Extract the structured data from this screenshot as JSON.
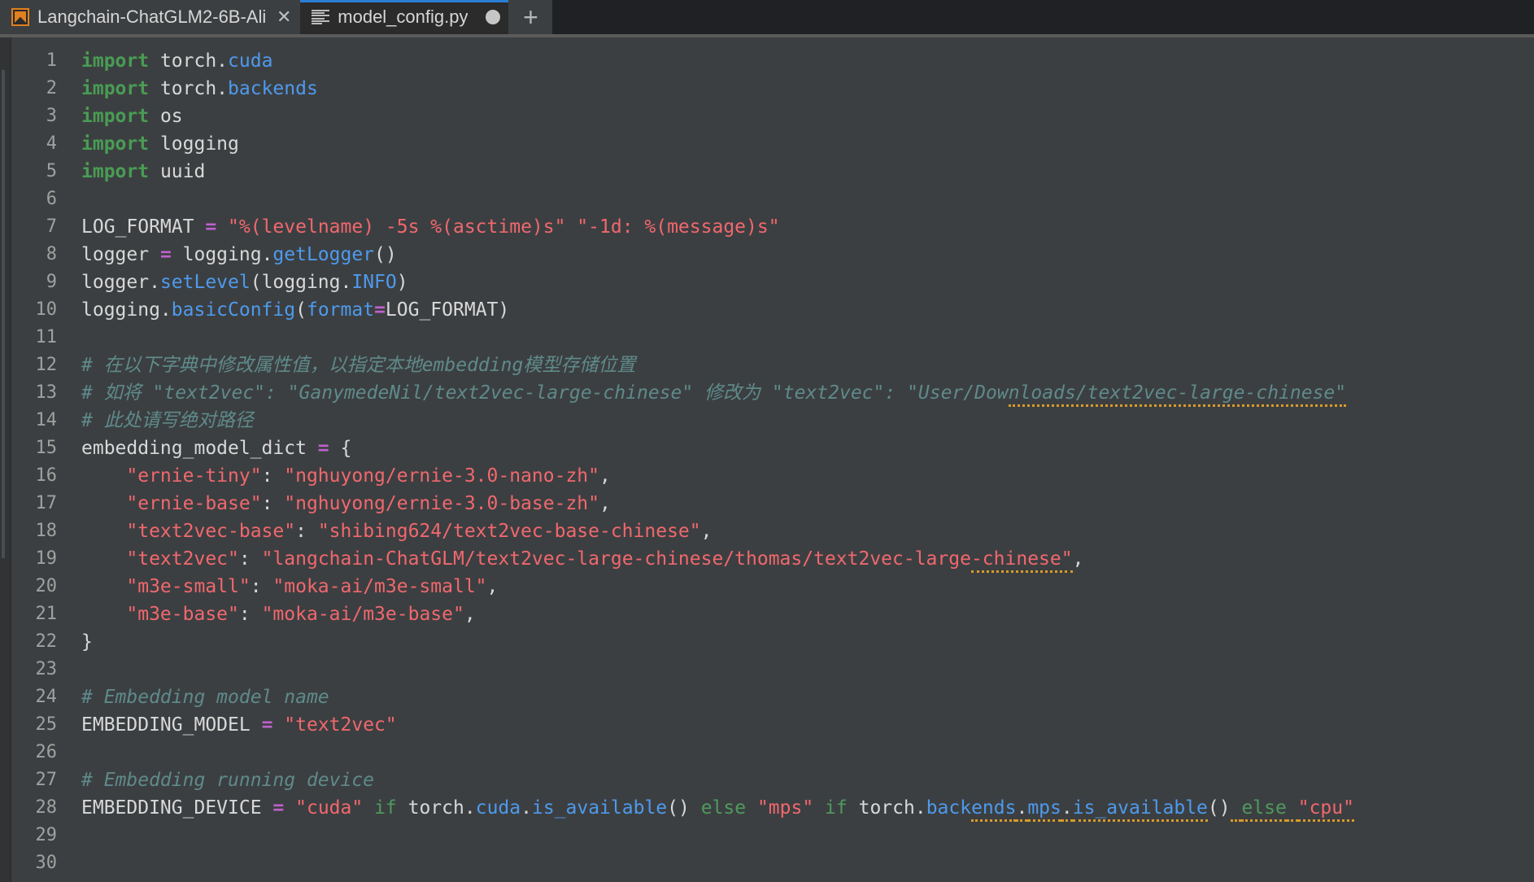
{
  "window": {
    "app": "PyCharm-like IDE",
    "theme_colors": {
      "tabbar_bg": "#202124",
      "tab_inactive_bg": "#3c3f41",
      "tab_active_bg": "#2b2b2b",
      "active_tab_accent": "#2a7fd4",
      "editor_bg": "#3c3f41",
      "gutter_text": "#a0a0a0",
      "keyword": "#499c54",
      "module": "#4e9aed",
      "string": "#f0686e",
      "operator": "#c061d0",
      "comment": "#5f8a8b",
      "typo_underline": "#d79b2a"
    }
  },
  "tabbar": {
    "tabs": [
      {
        "label": "Langchain-ChatGLM2-6B-Ali",
        "icon": "project-icon",
        "active": false,
        "close_label": "✕"
      },
      {
        "label": "model_config.py",
        "icon": "python-file-icon",
        "active": true,
        "modified": true
      }
    ],
    "new_tab_label": "+"
  },
  "editor": {
    "first_visible_line": 1,
    "last_visible_line": 30,
    "line_numbers": [
      1,
      2,
      3,
      4,
      5,
      6,
      7,
      8,
      9,
      10,
      11,
      12,
      13,
      14,
      15,
      16,
      17,
      18,
      19,
      20,
      21,
      22,
      23,
      24,
      25,
      26,
      27,
      28,
      29,
      30
    ],
    "lines": [
      {
        "n": 1,
        "tokens": [
          {
            "t": "import",
            "c": "kw"
          },
          {
            "t": " torch.",
            "c": "plain"
          },
          {
            "t": "cuda",
            "c": "mod"
          }
        ]
      },
      {
        "n": 2,
        "tokens": [
          {
            "t": "import",
            "c": "kw"
          },
          {
            "t": " torch.",
            "c": "plain"
          },
          {
            "t": "backends",
            "c": "mod"
          }
        ]
      },
      {
        "n": 3,
        "tokens": [
          {
            "t": "import",
            "c": "kw"
          },
          {
            "t": " os",
            "c": "plain"
          }
        ]
      },
      {
        "n": 4,
        "tokens": [
          {
            "t": "import",
            "c": "kw"
          },
          {
            "t": " logging",
            "c": "plain"
          }
        ]
      },
      {
        "n": 5,
        "tokens": [
          {
            "t": "import",
            "c": "kw"
          },
          {
            "t": " uuid",
            "c": "plain"
          }
        ]
      },
      {
        "n": 6,
        "tokens": []
      },
      {
        "n": 7,
        "tokens": [
          {
            "t": "LOG_FORMAT ",
            "c": "plain"
          },
          {
            "t": "=",
            "c": "op"
          },
          {
            "t": " ",
            "c": "plain"
          },
          {
            "t": "\"%(levelname) -5s %(asctime)s\" \"-1d: %(message)s\"",
            "c": "str"
          }
        ]
      },
      {
        "n": 8,
        "tokens": [
          {
            "t": "logger ",
            "c": "plain"
          },
          {
            "t": "=",
            "c": "op"
          },
          {
            "t": " logging.",
            "c": "plain"
          },
          {
            "t": "getLogger",
            "c": "mod"
          },
          {
            "t": "()",
            "c": "plain"
          }
        ]
      },
      {
        "n": 9,
        "tokens": [
          {
            "t": "logger.",
            "c": "plain"
          },
          {
            "t": "setLevel",
            "c": "mod"
          },
          {
            "t": "(logging.",
            "c": "plain"
          },
          {
            "t": "INFO",
            "c": "mod"
          },
          {
            "t": ")",
            "c": "plain"
          }
        ]
      },
      {
        "n": 10,
        "tokens": [
          {
            "t": "logging.",
            "c": "plain"
          },
          {
            "t": "basicConfig",
            "c": "mod"
          },
          {
            "t": "(",
            "c": "plain"
          },
          {
            "t": "format",
            "c": "mod"
          },
          {
            "t": "=",
            "c": "op"
          },
          {
            "t": "LOG_FORMAT)",
            "c": "plain"
          }
        ]
      },
      {
        "n": 11,
        "tokens": []
      },
      {
        "n": 12,
        "tokens": [
          {
            "t": "# 在以下字典中修改属性值，以指定本地embedding模型存储位置",
            "c": "cmt"
          }
        ]
      },
      {
        "n": 13,
        "tokens": [
          {
            "t": "# 如将 \"text2vec\": \"GanymedeNil/text2vec-large-chinese\" 修改为 \"text2vec\": \"User/Dow",
            "c": "cmt"
          },
          {
            "t": "nloads/text2vec-large-chinese\"",
            "c": "cmt typo"
          }
        ]
      },
      {
        "n": 14,
        "tokens": [
          {
            "t": "# 此处请写绝对路径",
            "c": "cmt"
          }
        ]
      },
      {
        "n": 15,
        "tokens": [
          {
            "t": "embedding_model_dict ",
            "c": "plain"
          },
          {
            "t": "=",
            "c": "op"
          },
          {
            "t": " {",
            "c": "plain"
          }
        ]
      },
      {
        "n": 16,
        "tokens": [
          {
            "t": "    ",
            "c": "plain"
          },
          {
            "t": "\"ernie-tiny\"",
            "c": "str"
          },
          {
            "t": ": ",
            "c": "plain"
          },
          {
            "t": "\"nghuyong/ernie-3.0-nano-zh\"",
            "c": "str"
          },
          {
            "t": ",",
            "c": "plain"
          }
        ]
      },
      {
        "n": 17,
        "tokens": [
          {
            "t": "    ",
            "c": "plain"
          },
          {
            "t": "\"ernie-base\"",
            "c": "str"
          },
          {
            "t": ": ",
            "c": "plain"
          },
          {
            "t": "\"nghuyong/ernie-3.0-base-zh\"",
            "c": "str"
          },
          {
            "t": ",",
            "c": "plain"
          }
        ]
      },
      {
        "n": 18,
        "tokens": [
          {
            "t": "    ",
            "c": "plain"
          },
          {
            "t": "\"text2vec-base\"",
            "c": "str"
          },
          {
            "t": ": ",
            "c": "plain"
          },
          {
            "t": "\"shibing624/text2vec-base-chinese\"",
            "c": "str"
          },
          {
            "t": ",",
            "c": "plain"
          }
        ]
      },
      {
        "n": 19,
        "tokens": [
          {
            "t": "    ",
            "c": "plain"
          },
          {
            "t": "\"text2vec\"",
            "c": "str"
          },
          {
            "t": ": ",
            "c": "plain"
          },
          {
            "t": "\"langchain-ChatGLM/text2vec-large-chinese/thomas/text2vec-large",
            "c": "str"
          },
          {
            "t": "-chinese\"",
            "c": "str typo"
          },
          {
            "t": ",",
            "c": "plain"
          }
        ]
      },
      {
        "n": 20,
        "tokens": [
          {
            "t": "    ",
            "c": "plain"
          },
          {
            "t": "\"m3e-small\"",
            "c": "str"
          },
          {
            "t": ": ",
            "c": "plain"
          },
          {
            "t": "\"moka-ai/m3e-small\"",
            "c": "str"
          },
          {
            "t": ",",
            "c": "plain"
          }
        ]
      },
      {
        "n": 21,
        "tokens": [
          {
            "t": "    ",
            "c": "plain"
          },
          {
            "t": "\"m3e-base\"",
            "c": "str"
          },
          {
            "t": ": ",
            "c": "plain"
          },
          {
            "t": "\"moka-ai/m3e-base\"",
            "c": "str"
          },
          {
            "t": ",",
            "c": "plain"
          }
        ]
      },
      {
        "n": 22,
        "tokens": [
          {
            "t": "}",
            "c": "plain"
          }
        ]
      },
      {
        "n": 23,
        "tokens": []
      },
      {
        "n": 24,
        "tokens": [
          {
            "t": "# Embedding model name",
            "c": "cmt"
          }
        ]
      },
      {
        "n": 25,
        "tokens": [
          {
            "t": "EMBEDDING_MODEL ",
            "c": "plain"
          },
          {
            "t": "=",
            "c": "op"
          },
          {
            "t": " ",
            "c": "plain"
          },
          {
            "t": "\"text2vec\"",
            "c": "str"
          }
        ]
      },
      {
        "n": 26,
        "tokens": []
      },
      {
        "n": 27,
        "tokens": [
          {
            "t": "# Embedding running device",
            "c": "cmt"
          }
        ]
      },
      {
        "n": 28,
        "tokens": [
          {
            "t": "EMBEDDING_DEVICE ",
            "c": "plain"
          },
          {
            "t": "=",
            "c": "op"
          },
          {
            "t": " ",
            "c": "plain"
          },
          {
            "t": "\"cuda\"",
            "c": "str"
          },
          {
            "t": " ",
            "c": "plain"
          },
          {
            "t": "if",
            "c": "kw2"
          },
          {
            "t": " torch.",
            "c": "plain"
          },
          {
            "t": "cuda",
            "c": "mod"
          },
          {
            "t": ".",
            "c": "plain"
          },
          {
            "t": "is_available",
            "c": "mod"
          },
          {
            "t": "() ",
            "c": "plain"
          },
          {
            "t": "else",
            "c": "kw2"
          },
          {
            "t": " ",
            "c": "plain"
          },
          {
            "t": "\"mps\"",
            "c": "str"
          },
          {
            "t": " ",
            "c": "plain"
          },
          {
            "t": "if",
            "c": "kw2"
          },
          {
            "t": " torch.",
            "c": "plain"
          },
          {
            "t": "back",
            "c": "mod"
          },
          {
            "t": "ends",
            "c": "mod typo"
          },
          {
            "t": ".",
            "c": "plain typo"
          },
          {
            "t": "mps",
            "c": "mod typo"
          },
          {
            "t": ".",
            "c": "plain typo"
          },
          {
            "t": "is_available",
            "c": "mod typo"
          },
          {
            "t": "()",
            "c": "plain"
          },
          {
            "t": " ",
            "c": "plain typo"
          },
          {
            "t": "else",
            "c": "kw2 typo"
          },
          {
            "t": " ",
            "c": "plain typo"
          },
          {
            "t": "\"cpu\"",
            "c": "str typo"
          }
        ]
      },
      {
        "n": 29,
        "tokens": []
      },
      {
        "n": 30,
        "tokens": []
      }
    ]
  }
}
